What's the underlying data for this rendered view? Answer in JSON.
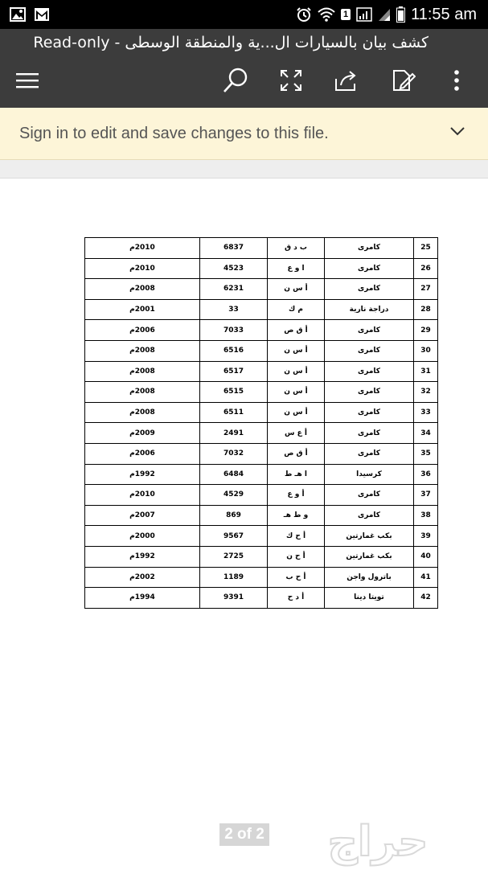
{
  "status_bar": {
    "time": "11:55 am",
    "sim_label": "1",
    "icons": [
      "gallery-icon",
      "gmail-icon",
      "alarm-icon",
      "wifi-icon",
      "signal-icon",
      "battery-icon"
    ]
  },
  "app_bar": {
    "title": "كشف بيان بالسيارات ال...ية والمنطقة الوسطى - Read-only",
    "icons": [
      "menu-icon",
      "search-icon",
      "fullscreen-icon",
      "share-icon",
      "edit-icon",
      "more-vert-icon"
    ]
  },
  "signin": {
    "message": "Sign in to edit and save changes to this file."
  },
  "table": {
    "rows": [
      {
        "num": "25",
        "model": "كامرى",
        "letters": "ب د ق",
        "plate": "6837",
        "year": "2010م"
      },
      {
        "num": "26",
        "model": "كامرى",
        "letters": "ا و ع",
        "plate": "4523",
        "year": "2010م"
      },
      {
        "num": "27",
        "model": "كامرى",
        "letters": "أ س ن",
        "plate": "6231",
        "year": "2008م"
      },
      {
        "num": "28",
        "model": "دراجة نارية",
        "letters": "م ك",
        "plate": "33",
        "year": "2001م"
      },
      {
        "num": "29",
        "model": "كامرى",
        "letters": "أ ق ص",
        "plate": "7033",
        "year": "2006م"
      },
      {
        "num": "30",
        "model": "كامرى",
        "letters": "أ س ن",
        "plate": "6516",
        "year": "2008م"
      },
      {
        "num": "31",
        "model": "كامرى",
        "letters": "أ س ن",
        "plate": "6517",
        "year": "2008م"
      },
      {
        "num": "32",
        "model": "كامرى",
        "letters": "أ س ن",
        "plate": "6515",
        "year": "2008م"
      },
      {
        "num": "33",
        "model": "كامرى",
        "letters": "أ س ن",
        "plate": "6511",
        "year": "2008م"
      },
      {
        "num": "34",
        "model": "كامرى",
        "letters": "أ ع س",
        "plate": "2491",
        "year": "2009م"
      },
      {
        "num": "35",
        "model": "كامرى",
        "letters": "أ ق ص",
        "plate": "7032",
        "year": "2006م"
      },
      {
        "num": "36",
        "model": "كرسيدا",
        "letters": "ا هـ ط",
        "plate": "6484",
        "year": "1992م"
      },
      {
        "num": "37",
        "model": "كامرى",
        "letters": "أ و ع",
        "plate": "4529",
        "year": "2010م"
      },
      {
        "num": "38",
        "model": "كامرى",
        "letters": "و ط هـ",
        "plate": "869",
        "year": "2007م"
      },
      {
        "num": "39",
        "model": "بكب غمارتين",
        "letters": "أ ح ك",
        "plate": "9567",
        "year": "2000م"
      },
      {
        "num": "40",
        "model": "بكب غمارتين",
        "letters": "أ ح ن",
        "plate": "2725",
        "year": "1992م"
      },
      {
        "num": "41",
        "model": "باترول واجن",
        "letters": "أ ح ب",
        "plate": "1189",
        "year": "2002م"
      },
      {
        "num": "42",
        "model": "تويتا دينا",
        "letters": "أ د ح",
        "plate": "9391",
        "year": "1994م"
      }
    ]
  },
  "pager": {
    "label": "2 of 2"
  },
  "watermark": {
    "text": "حراج"
  },
  "colors": {
    "app_bar": "#3c3c3c",
    "signin_bg": "#fdf5d8",
    "status_bar": "#000000"
  }
}
